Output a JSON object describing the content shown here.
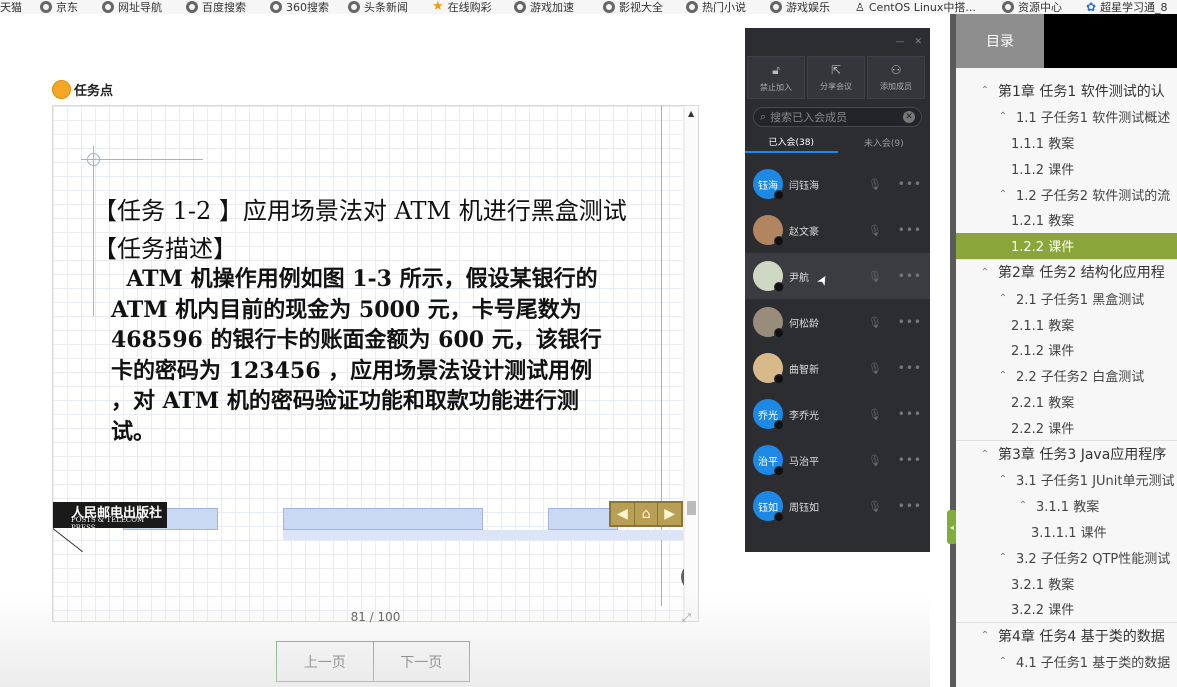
{
  "bookmarks": [
    {
      "label": "天猫",
      "icon": "globe-icon"
    },
    {
      "label": "京东",
      "icon": "globe-icon"
    },
    {
      "label": "网址导航",
      "icon": "globe-icon"
    },
    {
      "label": "百度搜索",
      "icon": "globe-icon"
    },
    {
      "label": "360搜索",
      "icon": "globe-icon"
    },
    {
      "label": "头条新闻",
      "icon": "globe-icon"
    },
    {
      "label": "在线购彩",
      "icon": "star-icon"
    },
    {
      "label": "游戏加速",
      "icon": "globe-icon"
    },
    {
      "label": "影视大全",
      "icon": "globe-icon"
    },
    {
      "label": "热门小说",
      "icon": "globe-icon"
    },
    {
      "label": "游戏娱乐",
      "icon": "globe-icon"
    },
    {
      "label": "CentOS Linux中搭...",
      "icon": "tux-icon"
    },
    {
      "label": "资源中心",
      "icon": "globe-icon"
    },
    {
      "label": "超星学习通_8",
      "icon": "paw-icon"
    }
  ],
  "task_point": {
    "label": "任务点",
    "icon_color": "#f5a623"
  },
  "document": {
    "title": "【任务 1-2 】应用场景法对 ATM 机进行黑盒测试",
    "subtitle": "【任务描述】",
    "body_lines": [
      "  ATM 机操作用例如图 1-3 所示，假设某银行的",
      "ATM 机内目前的现金为 5000 元，卡号尾数为",
      "468596 的银行卡的账面金额为 600 元，该银行",
      "卡的密码为 123456 ，应用场景法设计测试用例",
      "，对 ATM 机的密码验证功能和取款功能进行测",
      "试。"
    ],
    "publisher_cn": "人民邮电出版社",
    "publisher_en": "POSTS & TELECOM PRESS",
    "page_indicator": "81 / 100"
  },
  "pager": {
    "prev": "上一页",
    "next": "下一页"
  },
  "meeting": {
    "actions": [
      {
        "label": "禁止加入",
        "icon": "lock-icon"
      },
      {
        "label": "分享会议",
        "icon": "share-icon"
      },
      {
        "label": "添加成员",
        "icon": "add-user-icon"
      }
    ],
    "search_placeholder": "搜索已入会成员",
    "tabs": [
      {
        "label": "已入会(38)",
        "active": true
      },
      {
        "label": "未入会(9)",
        "active": false
      }
    ],
    "members": [
      {
        "name": "闫钰海",
        "avatar_text": "钰海",
        "avatar_color": "#1e88e5"
      },
      {
        "name": "赵文豪",
        "avatar_text": "",
        "avatar_color": "#b08560"
      },
      {
        "name": "尹航",
        "avatar_text": "",
        "avatar_color": "#cfd8c2"
      },
      {
        "name": "何松龄",
        "avatar_text": "",
        "avatar_color": "#9a8c7a"
      },
      {
        "name": "曲智新",
        "avatar_text": "",
        "avatar_color": "#d8b98a"
      },
      {
        "name": "李乔光",
        "avatar_text": "乔光",
        "avatar_color": "#1e88e5"
      },
      {
        "name": "马治平",
        "avatar_text": "治平",
        "avatar_color": "#1e88e5"
      },
      {
        "name": "周钰如",
        "avatar_text": "钰如",
        "avatar_color": "#1e88e5"
      }
    ]
  },
  "toc": {
    "tab_label": "目录",
    "items": [
      {
        "label": "第1章 任务1 软件测试的认",
        "level": 0,
        "chev": true
      },
      {
        "label": "1.1 子任务1 软件测试概述",
        "level": 1,
        "chev": true
      },
      {
        "label": "1.1.1 教案",
        "level": 2,
        "chev": false
      },
      {
        "label": "1.1.2 课件",
        "level": 2,
        "chev": false
      },
      {
        "label": "1.2 子任务2 软件测试的流",
        "level": 1,
        "chev": true
      },
      {
        "label": "1.2.1 教案",
        "level": 2,
        "chev": false
      },
      {
        "label": "1.2.2 课件",
        "level": 2,
        "chev": false,
        "selected": true
      },
      {
        "label": "第2章 任务2 结构化应用程",
        "level": 0,
        "chev": true
      },
      {
        "label": "2.1 子任务1 黑盒测试",
        "level": 1,
        "chev": true
      },
      {
        "label": "2.1.1 教案",
        "level": 2,
        "chev": false
      },
      {
        "label": "2.1.2 课件",
        "level": 2,
        "chev": false
      },
      {
        "label": "2.2 子任务2 白盒测试",
        "level": 1,
        "chev": true
      },
      {
        "label": "2.2.1 教案",
        "level": 2,
        "chev": false
      },
      {
        "label": "2.2.2 课件",
        "level": 2,
        "chev": false
      },
      {
        "label": "第3章 任务3 Java应用程序",
        "level": 0,
        "chev": true
      },
      {
        "label": "3.1 子任务1 JUnit单元测试",
        "level": 1,
        "chev": true
      },
      {
        "label": "3.1.1 教案",
        "level": 3,
        "chev": true
      },
      {
        "label": "3.1.1.1 课件",
        "level": 4,
        "chev": false
      },
      {
        "label": "3.2 子任务2 QTP性能测试",
        "level": 1,
        "chev": true
      },
      {
        "label": "3.2.1 教案",
        "level": 2,
        "chev": false
      },
      {
        "label": "3.2.2 课件",
        "level": 2,
        "chev": false
      },
      {
        "label": "第4章 任务4 基于类的数据",
        "level": 0,
        "chev": true
      },
      {
        "label": "4.1 子任务1 基于类的数据",
        "level": 1,
        "chev": true
      }
    ]
  }
}
